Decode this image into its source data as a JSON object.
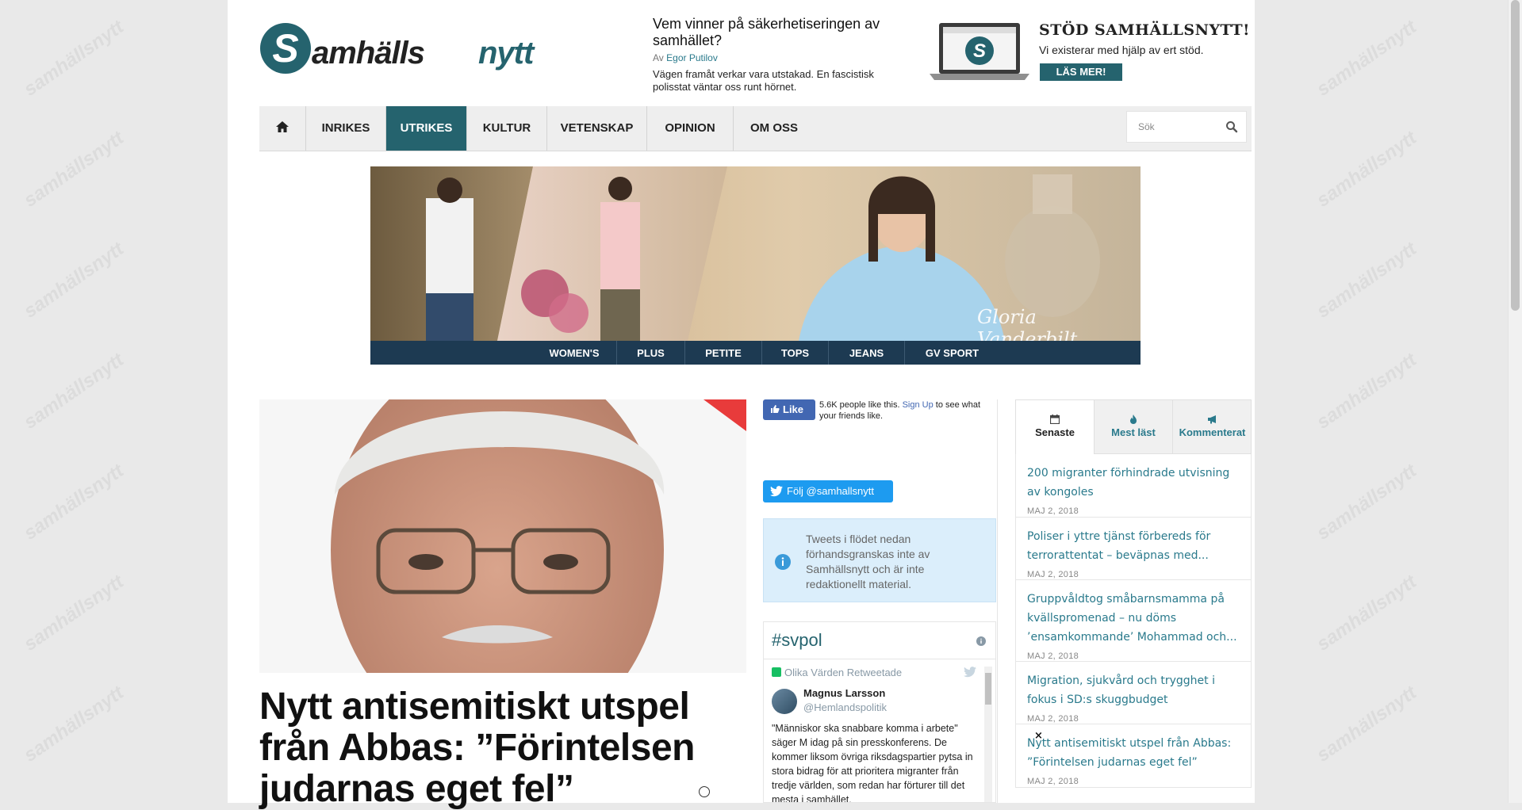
{
  "brand": {
    "logo_text": "Samhällsnytt",
    "accent": "#25636e",
    "link": "#2a7a8c"
  },
  "watermark_text": "samhällsnytt",
  "featured": {
    "title": "Vem vinner på säkerhetiseringen av samhället?",
    "by_prefix": "Av",
    "author": "Egor Putilov",
    "description": "Vägen framåt verkar vara utstakad. En fascistisk polisstat väntar oss runt hörnet."
  },
  "support": {
    "title": "STÖD SAMHÄLLSNYTT!",
    "subtitle": "Vi existerar med hjälp av ert stöd.",
    "button": "LÄS MER!"
  },
  "nav": {
    "home_icon": "home-icon",
    "items": [
      {
        "label": "INRIKES",
        "active": false
      },
      {
        "label": "UTRIKES",
        "active": true
      },
      {
        "label": "KULTUR",
        "active": false
      },
      {
        "label": "VETENSKAP",
        "active": false
      },
      {
        "label": "OPINION",
        "active": false
      },
      {
        "label": "OM OSS",
        "active": false
      }
    ],
    "search_placeholder": "Sök"
  },
  "ad": {
    "signature": "Gloria Vanderbilt",
    "links": [
      "WOMEN'S",
      "PLUS",
      "PETITE",
      "TOPS",
      "JEANS",
      "GV SPORT"
    ]
  },
  "article": {
    "title": "Nytt antisemitiskt utspel från Abbas: ”Förintelsen judarnas eget fel”"
  },
  "social": {
    "fb_like": "Like",
    "fb_count_text": "5.6K people like this.",
    "fb_signup": "Sign Up",
    "fb_rest": "to see what your friends like.",
    "twitter_follow": "Följ @samhallsnytt",
    "notice": "Tweets i flödet nedan förhandsgranskas inte av Samhällsnytt och är inte redaktionellt material.",
    "hashtag": "#svpol",
    "tweet": {
      "retweeted_by": "Olika Värden Retweetade",
      "name": "Magnus Larsson",
      "handle": "@Hemlandspolitik",
      "text": "\"Människor ska snabbare komma i arbete\" säger M idag på sin presskonferens. De kommer liksom övriga riksdagspartier pytsa in stora bidrag för att prioritera migranter från tredje världen, som redan har förturer till det mesta i samhället."
    }
  },
  "tabs": [
    {
      "label": "Senaste",
      "icon": "calendar-icon",
      "active": true
    },
    {
      "label": "Mest läst",
      "icon": "fire-icon",
      "active": false
    },
    {
      "label": "Kommenterat",
      "icon": "megaphone-icon",
      "active": false
    }
  ],
  "latest": [
    {
      "title": "200 migranter förhindrade utvisning av kongoles",
      "date": "MAJ 2, 2018"
    },
    {
      "title": "Poliser i yttre tjänst förbereds för terrorattentat – beväpnas med...",
      "date": "MAJ 2, 2018"
    },
    {
      "title": "Gruppvåldtog småbarnsmamma på kvällspromenad – nu döms ’ensamkommande’ Mohammad och...",
      "date": "MAJ 2, 2018"
    },
    {
      "title": "Migration, sjukvård och trygghet i fokus i SD:s skuggbudget",
      "date": "MAJ 2, 2018"
    },
    {
      "title": "Nytt antisemitiskt utspel från Abbas: ”Förintelsen judarnas eget fel”",
      "date": "MAJ 2, 2018"
    }
  ],
  "overlay_close": "×"
}
